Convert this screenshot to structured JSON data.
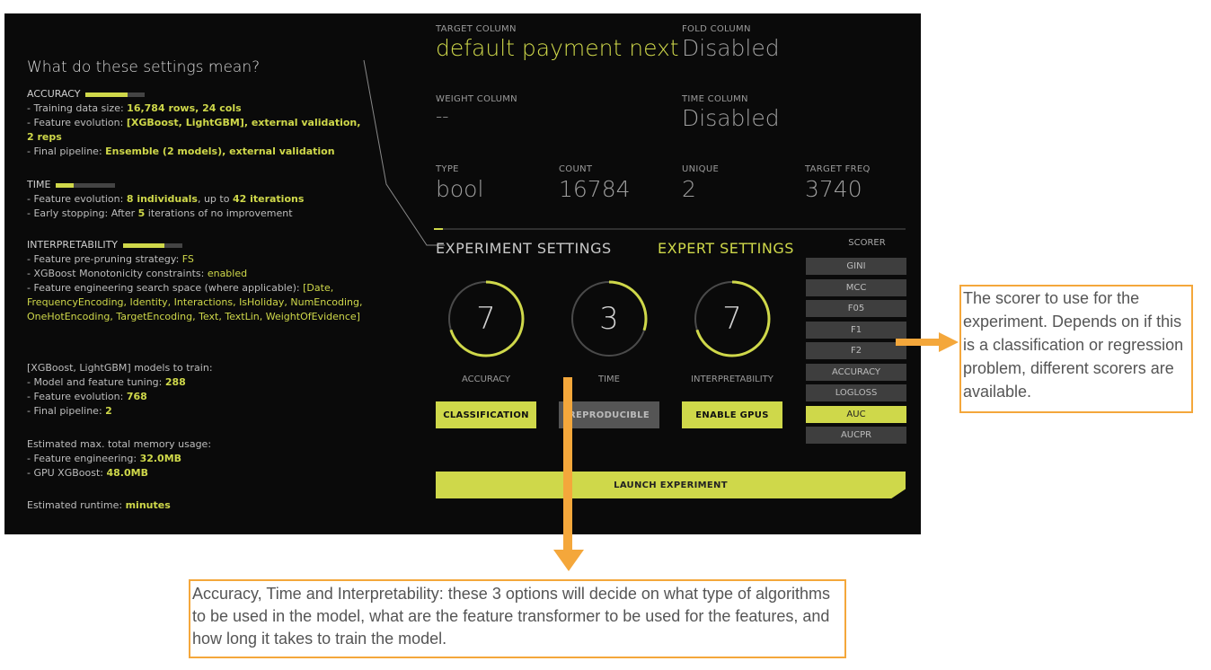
{
  "help": {
    "title": "What do these settings mean?",
    "accuracy_label": "ACCURACY",
    "accuracy_level": 0.7,
    "accuracy_lines": [
      {
        "pre": "- Training data size: ",
        "hl": "16,784 rows, 24 cols",
        "post": ""
      },
      {
        "pre": "- Feature evolution: ",
        "hl": "[XGBoost, LightGBM], external validation, 2 reps",
        "post": ""
      },
      {
        "pre": "- Final pipeline: ",
        "hl": "Ensemble (2 models), external validation",
        "post": ""
      }
    ],
    "time_label": "TIME",
    "time_level": 0.3,
    "time_line1_pre": "- Feature evolution: ",
    "time_line1_hl1": "8 individuals",
    "time_line1_mid": ", up to ",
    "time_line1_hl2": "42 iterations",
    "time_line2_pre": "- Early stopping: After ",
    "time_line2_hl": "5",
    "time_line2_post": " iterations of no improvement",
    "interp_label": "INTERPRETABILITY",
    "interp_level": 0.7,
    "interp_line1_pre": "- Feature pre-pruning strategy: ",
    "interp_line1_hl": "FS",
    "interp_line2_pre": "- XGBoost Monotonicity constraints: ",
    "interp_line2_hl": "enabled",
    "interp_line3_pre": "- Feature engineering search space (where applicable): ",
    "interp_line3_hl": "[Date, FrequencyEncoding, Identity, Interactions, IsHoliday, NumEncoding, OneHotEncoding, TargetEncoding, Text, TextLin, WeightOfEvidence]",
    "models_head": "[XGBoost, LightGBM] models to train:",
    "models_line1_pre": "- Model and feature tuning: ",
    "models_line1_hl": "288",
    "models_line2_pre": "- Feature evolution: ",
    "models_line2_hl": "768",
    "models_line3_pre": "- Final pipeline: ",
    "models_line3_hl": "2",
    "mem_head": "Estimated max. total memory usage:",
    "mem_line1_pre": "- Feature engineering: ",
    "mem_line1_hl": "32.0MB",
    "mem_line2_pre": "- GPU XGBoost: ",
    "mem_line2_hl": "48.0MB",
    "runtime_pre": "Estimated runtime: ",
    "runtime_hl": "minutes"
  },
  "fields": {
    "target_label": "TARGET COLUMN",
    "target_value": "default payment next",
    "fold_label": "FOLD COLUMN",
    "fold_value": "Disabled",
    "weight_label": "WEIGHT COLUMN",
    "weight_value": "--",
    "time_label": "TIME COLUMN",
    "time_value": "Disabled",
    "type_label": "TYPE",
    "type_value": "bool",
    "count_label": "COUNT",
    "count_value": "16784",
    "unique_label": "UNIQUE",
    "unique_value": "2",
    "freq_label": "TARGET FREQ",
    "freq_value": "3740"
  },
  "settings": {
    "experiment_title": "EXPERIMENT SETTINGS",
    "expert_title": "EXPERT SETTINGS",
    "accuracy": {
      "value": "7",
      "label": "ACCURACY",
      "level": 0.7
    },
    "time": {
      "value": "3",
      "label": "TIME",
      "level": 0.3
    },
    "interpretability": {
      "value": "7",
      "label": "INTERPRETABILITY",
      "level": 0.7
    },
    "btn_classification": "CLASSIFICATION",
    "btn_reproducible": "REPRODUCIBLE",
    "btn_gpus": "ENABLE GPUS",
    "launch": "LAUNCH EXPERIMENT"
  },
  "scorer": {
    "label": "SCORER",
    "items": [
      "GINI",
      "MCC",
      "F05",
      "F1",
      "F2",
      "ACCURACY",
      "LOGLOSS",
      "AUC",
      "AUCPR"
    ],
    "selected": "AUC"
  },
  "annotations": {
    "scorer_note": "The scorer to use for the experiment. Depends on if this is a classification or regression problem, different scorers are available.",
    "dials_note": "Accuracy, Time and Interpretability: these 3 options will decide on what type of algorithms to be used in the model, what are the feature transformer to be used for the features, and how long it takes to train the model.",
    "accent": "#f4a73b",
    "ui_accent": "#cfd84a"
  }
}
